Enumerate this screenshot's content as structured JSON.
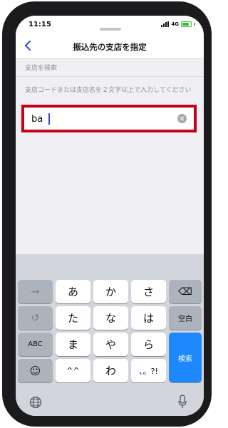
{
  "status_bar": {
    "time": "11:15",
    "network": "4G"
  },
  "nav": {
    "title": "振込先の支店を指定",
    "back_icon": "chevron-left-icon"
  },
  "section_label": "支店を検索",
  "hint": "支店コードまたは支店名を２文字以上で入力してください",
  "search": {
    "value": "ba",
    "placeholder": "",
    "clear_icon": "clear-circle-icon"
  },
  "keyboard": {
    "row1": [
      "→",
      "あ",
      "か",
      "さ",
      "⌫"
    ],
    "row2": [
      "↺",
      "た",
      "な",
      "は",
      "空白"
    ],
    "row3": [
      "ABC",
      "ま",
      "や",
      "ら"
    ],
    "row4": [
      "☺",
      "^^",
      "わ",
      "、。?!"
    ],
    "search_key": "検索",
    "globe_icon": "globe-icon",
    "mic_icon": "microphone-icon"
  },
  "colors": {
    "highlight": "#c4001b",
    "accent": "#1e88ff",
    "nav_tint": "#3a4ad8"
  }
}
